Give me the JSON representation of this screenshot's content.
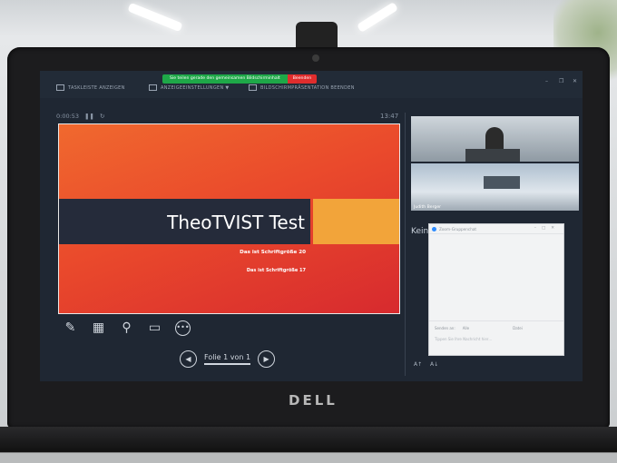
{
  "toolbar": {
    "taskbar_label": "TASKLEISTE ANZEIGEN",
    "display_settings_label": "ANZEIGEEINSTELLUNGEN ▼",
    "end_presentation_label": "BILDSCHIRMPRÄSENTATION BEENDEN"
  },
  "share_bar": {
    "status_text": "Sie teilen gerade den gemeinsamen Bildschirminhalt",
    "stop_label": "Beenden"
  },
  "window_controls": {
    "minimize": "–",
    "restore": "❐",
    "close": "✕"
  },
  "presenter": {
    "elapsed": "0:00:53",
    "clock": "13:47",
    "pause_icon": "pause-icon",
    "reset_icon": "reset-icon"
  },
  "slide": {
    "title": "TheoTVIST Test",
    "subtitle1": "Das ist Schriftgröße 20",
    "subtitle2": "Das ist Schriftgröße 17"
  },
  "tools": [
    "pen-icon",
    "slides-grid-icon",
    "zoom-icon",
    "screen-icon",
    "more-icon"
  ],
  "navigation": {
    "label": "Folie 1 von 1"
  },
  "video": {
    "participant_name": "Judith Berger"
  },
  "notes_panel": {
    "title": "Kein"
  },
  "zoom_buttons": [
    "A↑",
    "A↓"
  ],
  "chat": {
    "title": "Zoom-Gruppenchat",
    "send_to_label": "Senden an:",
    "recipient": "Alle",
    "file_label": "Datei",
    "input_placeholder": "Tippen Sie Ihre Nachricht hier…"
  },
  "device": {
    "brand": "DELL"
  },
  "colors": {
    "slide_orange": "#f0692e",
    "slide_red": "#d72a2e",
    "slide_band": "#252b3a",
    "slide_accent": "#f2a43a",
    "share_green": "#1ea848",
    "share_red": "#e02d2d",
    "screen_bg": "#1f2733"
  }
}
